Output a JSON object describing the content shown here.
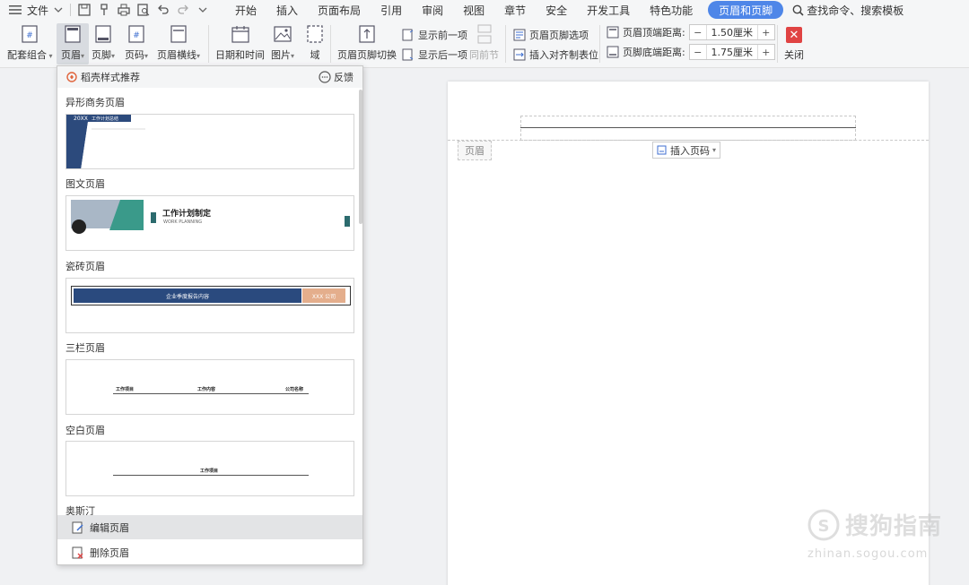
{
  "menubar": {
    "file": "文件",
    "tabs": [
      "开始",
      "插入",
      "页面布局",
      "引用",
      "审阅",
      "视图",
      "章节",
      "安全",
      "开发工具",
      "特色功能",
      "页眉和页脚"
    ],
    "search": "查找命令、搜索模板"
  },
  "ribbon": {
    "combo": "配套组合",
    "header": "页眉",
    "footer": "页脚",
    "pagenum": "页码",
    "hline": "页眉横线",
    "datetime": "日期和时间",
    "picture": "图片",
    "field": "域",
    "switch": "页眉页脚切换",
    "prev": "显示前一项",
    "next": "显示后一项",
    "same": "同前节",
    "options": "页眉页脚选项",
    "align_tab": "插入对齐制表位",
    "top_label": "页眉顶端距离:",
    "top_value": "1.50厘米",
    "bottom_label": "页脚底端距离:",
    "bottom_value": "1.75厘米",
    "close": "关闭"
  },
  "dropdown": {
    "title": "稻壳样式推荐",
    "feedback": "反馈",
    "sections": [
      {
        "title": "异形商务页眉",
        "t1": "20XX",
        "t2": "工作计划总结"
      },
      {
        "title": "图文页眉",
        "t1": "工作计划制定",
        "t2": "WORK PLANNING"
      },
      {
        "title": "瓷砖页眉",
        "t1": "企业季度报告内容",
        "t2": "XXX 公司"
      },
      {
        "title": "三栏页眉",
        "c1": "工作项目",
        "c2": "工作内容",
        "c3": "公司名称"
      },
      {
        "title": "空白页眉",
        "t1": "工作项目"
      }
    ],
    "last_section": "奥斯汀",
    "edit": "编辑页眉",
    "delete": "删除页眉"
  },
  "document": {
    "header_label": "页眉",
    "insert_page_number": "插入页码"
  },
  "watermark": {
    "text": "搜狗指南",
    "url": "zhinan.sogou.com"
  }
}
